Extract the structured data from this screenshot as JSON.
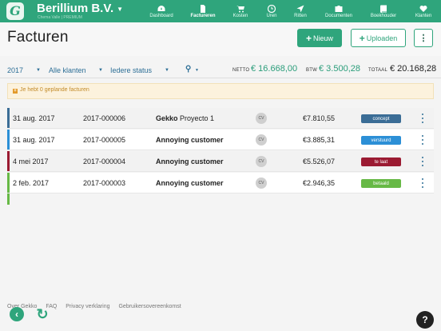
{
  "app": {
    "logo_letter": "G",
    "company": "Berillium B.V.",
    "subtitle": "Chema Valle | PREMIUM"
  },
  "nav": [
    {
      "label": "Dashboard",
      "icon": "dashboard-icon",
      "active": false
    },
    {
      "label": "Factureren",
      "icon": "document-icon",
      "active": true
    },
    {
      "label": "Kosten",
      "icon": "cart-icon",
      "active": false
    },
    {
      "label": "Uren",
      "icon": "clock-icon",
      "active": false
    },
    {
      "label": "Ritten",
      "icon": "location-arrow-icon",
      "active": false
    },
    {
      "label": "Documenten",
      "icon": "briefcase-icon",
      "active": false
    },
    {
      "label": "Boekhouder",
      "icon": "book-icon",
      "active": false
    },
    {
      "label": "Klanten",
      "icon": "heart-icon",
      "active": false
    }
  ],
  "page": {
    "title": "Facturen",
    "new_label": "Nieuw",
    "upload_label": "Uploaden",
    "more_label": "⋮"
  },
  "filters": {
    "year": "2017",
    "customers": "Alle klanten",
    "status": "Iedere status"
  },
  "totals": {
    "netto_label": "NETTO",
    "netto": "€ 16.668,00",
    "btw_label": "BTW",
    "btw": "€ 3.500,28",
    "totaal_label": "TOTAAL",
    "totaal": "€ 20.168,28"
  },
  "notice": {
    "text": "Je hebt 0 geplande facturen"
  },
  "invoices": [
    {
      "date": "31 aug. 2017",
      "number": "2017-000006",
      "customer_bold": "Gekko",
      "customer_rest": " Proyecto 1",
      "cv": "CV",
      "amount": "€7.810,55",
      "status": "concept"
    },
    {
      "date": "31 aug. 2017",
      "number": "2017-000005",
      "customer_bold": "Annoying customer",
      "customer_rest": "",
      "cv": "CV",
      "amount": "€3.885,31",
      "status": "verstuurd"
    },
    {
      "date": "4 mei 2017",
      "number": "2017-000004",
      "customer_bold": "Annoying customer",
      "customer_rest": "",
      "cv": "CV",
      "amount": "€5.526,07",
      "status": "te laat"
    },
    {
      "date": "2 feb. 2017",
      "number": "2017-000003",
      "customer_bold": "Annoying customer",
      "customer_rest": "",
      "cv": "CV",
      "amount": "€2.946,35",
      "status": "betaald"
    }
  ],
  "status_colors": {
    "concept": "#3b6d96",
    "verstuurd": "#2c8fd6",
    "te laat": "#9b1b32",
    "betaald": "#67b946"
  },
  "footer": {
    "links": [
      "Over Gekko",
      "FAQ",
      "Privacy verklaring",
      "Gebruikersovereenkomst"
    ],
    "help": "?"
  }
}
